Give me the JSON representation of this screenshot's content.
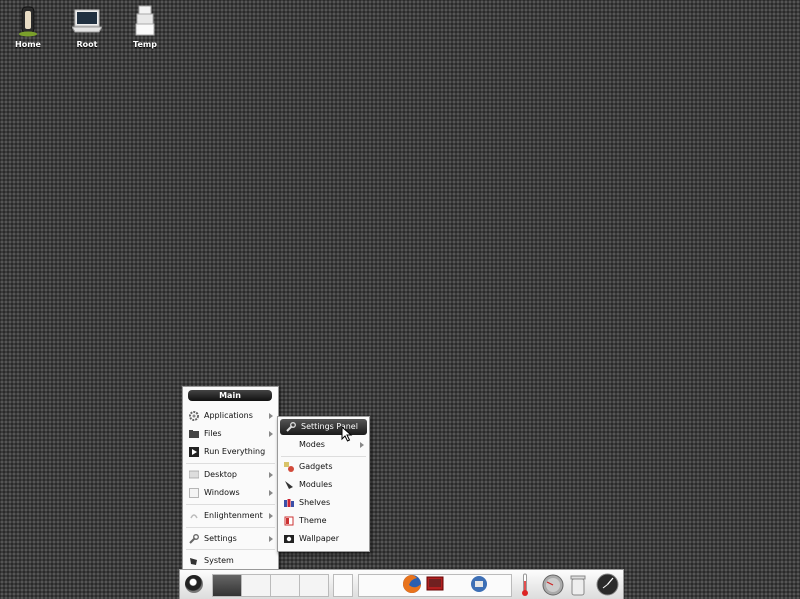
{
  "desktop": {
    "icons": [
      {
        "label": "Home",
        "icon": "home-icon"
      },
      {
        "label": "Root",
        "icon": "root-laptop-icon"
      },
      {
        "label": "Temp",
        "icon": "temp-icon"
      }
    ]
  },
  "main_menu": {
    "title": "Main",
    "items": [
      {
        "label": "Applications",
        "icon": "gear-icon",
        "has_submenu": true
      },
      {
        "label": "Files",
        "icon": "folder-icon",
        "has_submenu": true
      },
      {
        "label": "Run Everything",
        "icon": "run-icon",
        "has_submenu": false
      },
      {
        "label": "Desktop",
        "icon": "desktop-icon",
        "has_submenu": true
      },
      {
        "label": "Windows",
        "icon": "window-icon",
        "has_submenu": true
      },
      {
        "label": "Enlightenment",
        "icon": "enlightenment-icon",
        "has_submenu": true
      },
      {
        "label": "Settings",
        "icon": "wrench-icon",
        "has_submenu": true
      },
      {
        "label": "System",
        "icon": "system-icon",
        "has_submenu": false
      }
    ]
  },
  "settings_menu": {
    "items": [
      {
        "label": "Settings Panel",
        "icon": "wrench-icon",
        "active": true
      },
      {
        "label": "Modes",
        "icon": "",
        "has_submenu": true
      },
      {
        "label": "Gadgets",
        "icon": "gadgets-icon"
      },
      {
        "label": "Modules",
        "icon": "modules-icon"
      },
      {
        "label": "Shelves",
        "icon": "shelves-icon"
      },
      {
        "label": "Theme",
        "icon": "theme-icon"
      },
      {
        "label": "Wallpaper",
        "icon": "wallpaper-icon"
      }
    ]
  },
  "colors": {
    "menu_bg": "#fafafa",
    "active_bg": "#1a1a1a",
    "desktop_bg": "#3b3b3b"
  }
}
